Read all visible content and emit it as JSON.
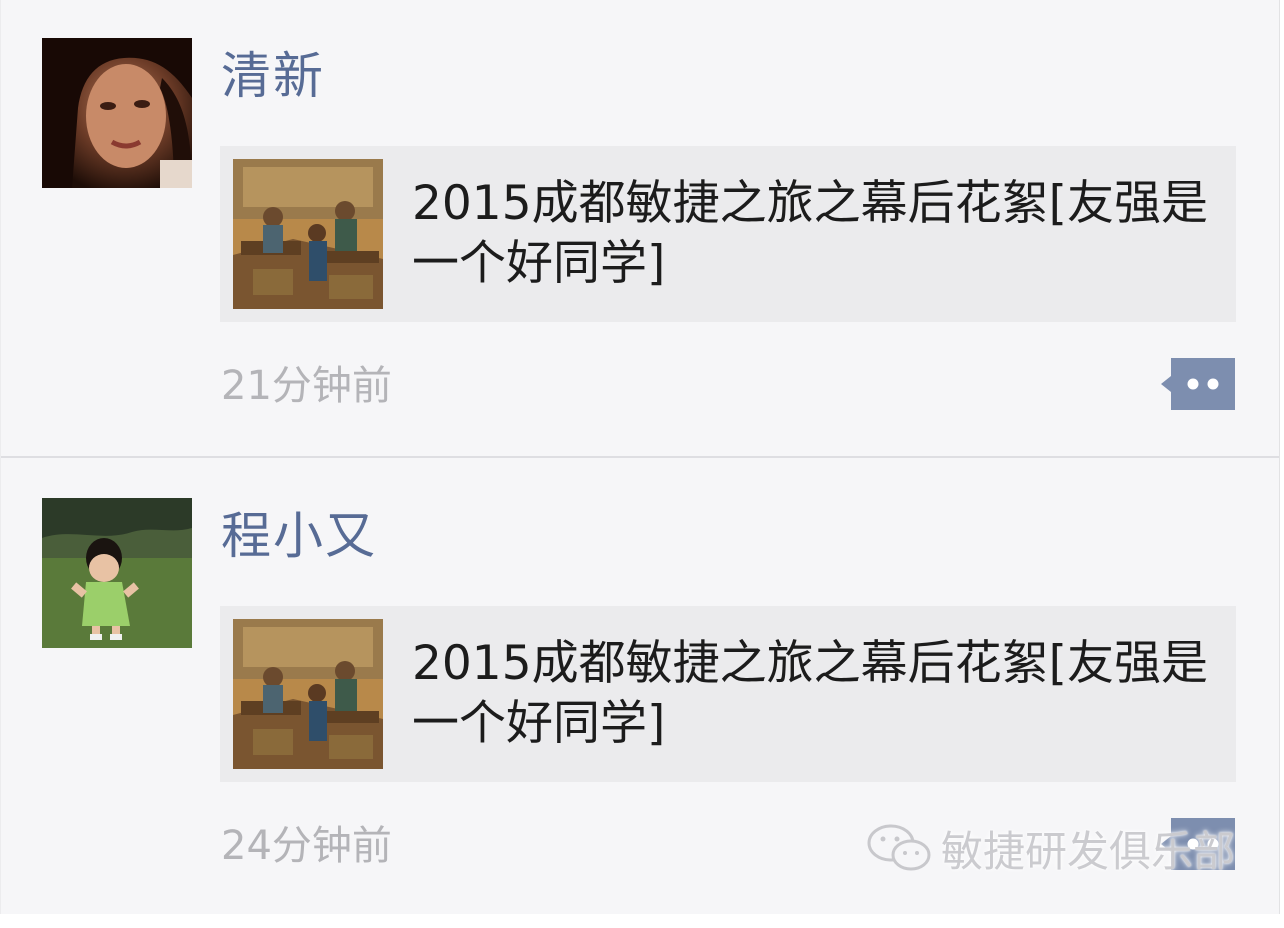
{
  "posts": [
    {
      "user": "清新",
      "avatar_icon": "user-photo-woman",
      "link": {
        "thumb_icon": "vintage-workshop-painting",
        "title": "2015成都敏捷之旅之幕后花絮[友强是一个好同学]"
      },
      "time": "21分钟前",
      "comment_icon": "comment-bubble-icon"
    },
    {
      "user": "程小又",
      "avatar_icon": "user-photo-child",
      "link": {
        "thumb_icon": "vintage-workshop-painting",
        "title": "2015成都敏捷之旅之幕后花絮[友强是一个好同学]"
      },
      "time": "24分钟前",
      "comment_icon": "comment-bubble-icon"
    }
  ],
  "watermark": {
    "text": "敏捷研发俱乐部",
    "icon": "wechat-icon"
  },
  "colors": {
    "username": "#576b95",
    "timestamp": "#b4b4b8",
    "card_bg": "#ebebed",
    "comment_btn": "#7d8eaf"
  }
}
